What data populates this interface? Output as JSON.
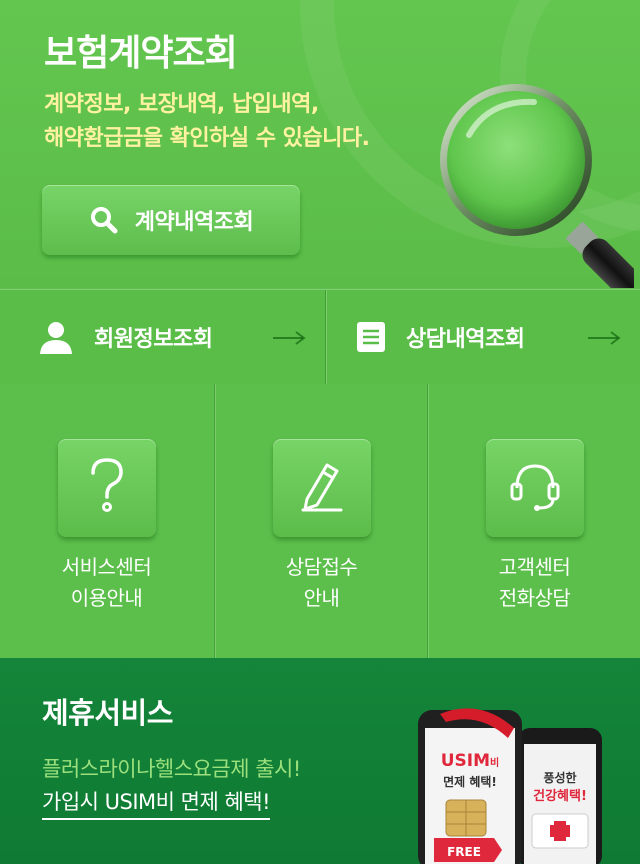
{
  "hero": {
    "title": "보험계약조회",
    "desc_line1": "계약정보, 보장내역, 납입내역,",
    "desc_line2": "해약환급금을 확인하실 수 있습니다.",
    "button_label": "계약내역조회",
    "button_icon": "search-icon",
    "illustration": "magnifying-glass"
  },
  "links": [
    {
      "label": "회원정보조회",
      "icon": "person-icon",
      "arrow": "right-arrow-icon"
    },
    {
      "label": "상담내역조회",
      "icon": "document-icon",
      "arrow": "right-arrow-icon"
    }
  ],
  "tiles": [
    {
      "line1": "서비스센터",
      "line2": "이용안내",
      "icon": "question-icon"
    },
    {
      "line1": "상담접수",
      "line2": "안내",
      "icon": "pencil-icon"
    },
    {
      "line1": "고객센터",
      "line2": "전화상담",
      "icon": "headset-icon"
    }
  ],
  "partner": {
    "title": "제휴서비스",
    "line1": "플러스라이나헬스요금제 출시!",
    "line2": "가입시 USIM비 면제 혜택!",
    "phone1": {
      "brand": "USIM",
      "brand_suffix": "비",
      "line": "면제 혜택!",
      "badge": "FREE"
    },
    "phone2": {
      "line1": "풍성한",
      "line2": "건강혜택!"
    }
  },
  "colors": {
    "primary_green": "#5cbf4b",
    "dark_green": "#12813a",
    "accent_yellow": "#fff2a0",
    "accent_light_green": "#9be07c"
  }
}
